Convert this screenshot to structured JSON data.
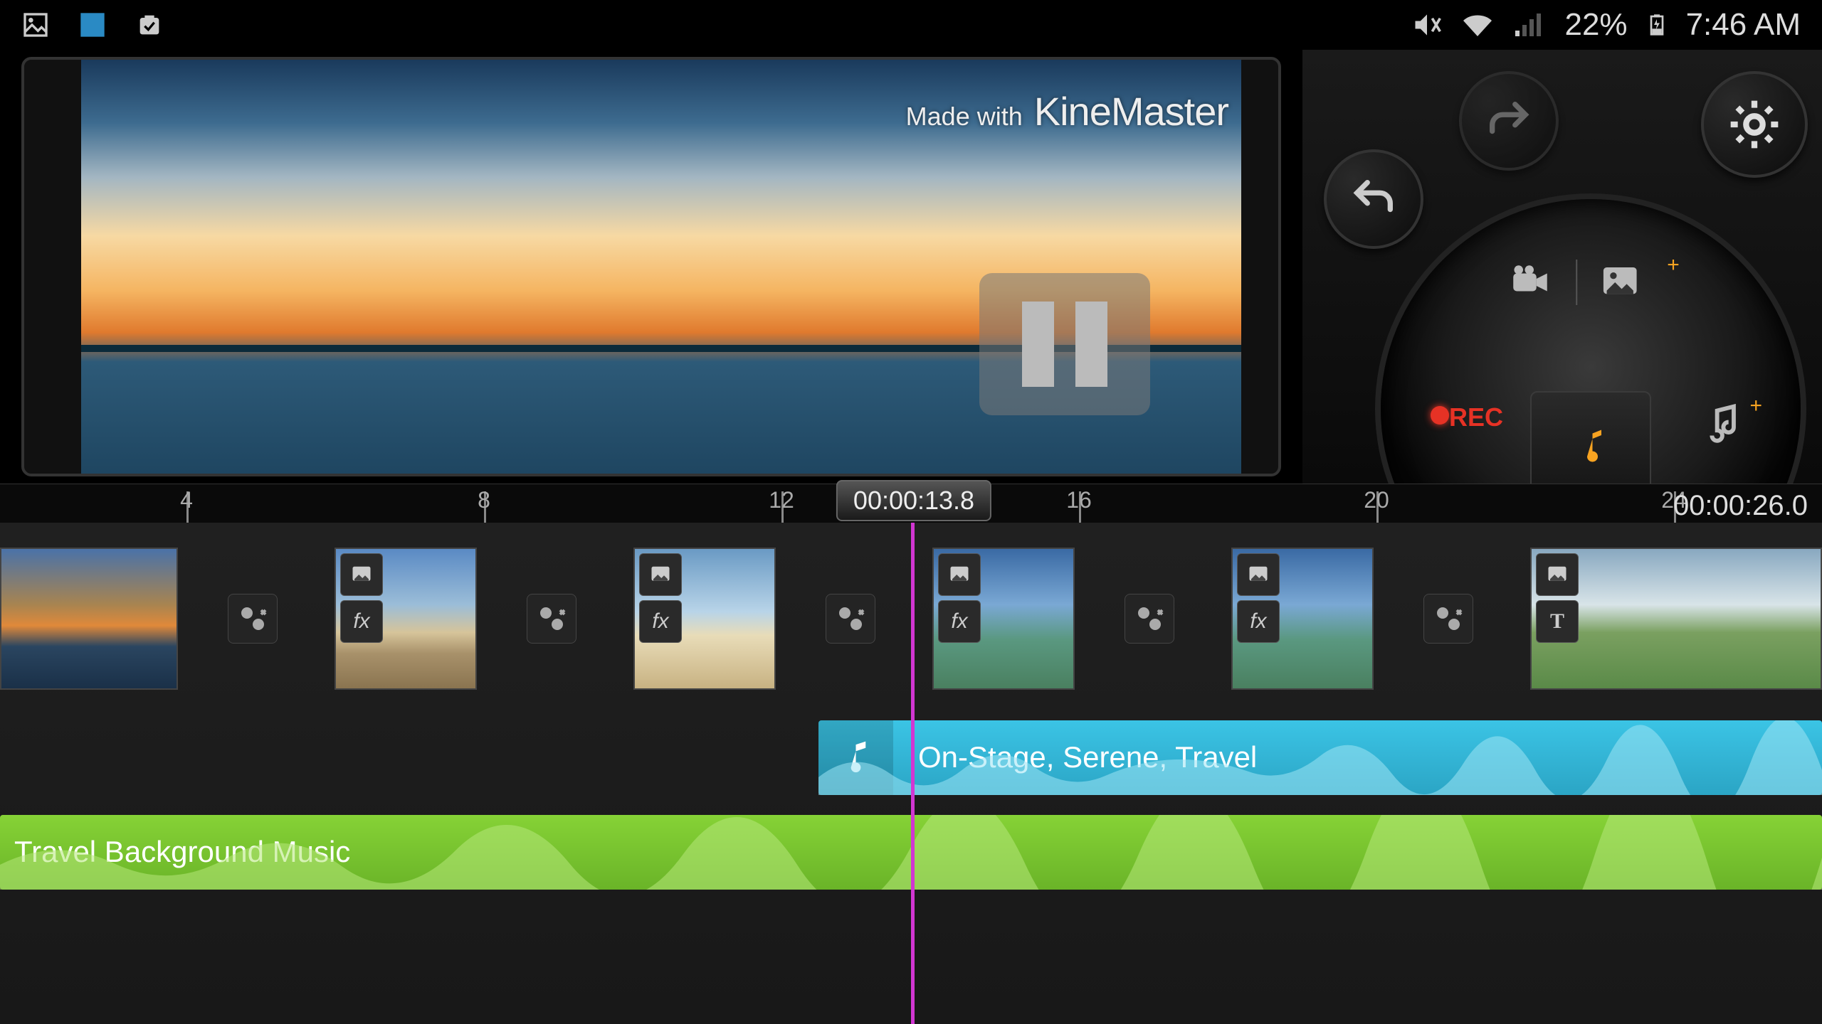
{
  "statusbar": {
    "battery_pct": "22%",
    "time": "7:46 AM"
  },
  "preview": {
    "watermark_prefix": "Made with",
    "watermark_brand": "KineMaster"
  },
  "controls": {
    "rec_label": "REC"
  },
  "ruler": {
    "ticks": [
      "4",
      "8",
      "12",
      "16",
      "20",
      "24"
    ],
    "playhead_time": "00:00:13.8",
    "total_time": "00:00:26.0"
  },
  "tracks": {
    "audio1_label": "On-Stage, Serene, Travel",
    "audio2_label": "Travel Background Music"
  },
  "badges": {
    "fx": "fx",
    "text": "T"
  }
}
